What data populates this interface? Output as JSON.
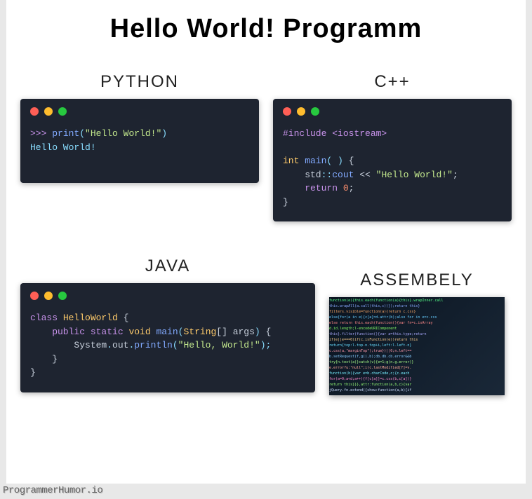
{
  "title": "Hello World!  Programm",
  "watermark": "ProgrammerHumor.io",
  "panels": {
    "python": {
      "label": "PYTHON",
      "code": {
        "prompt": ">>> ",
        "fn": "print",
        "open": "(",
        "str": "\"Hello World!\"",
        "close": ")",
        "output": "Hello World!"
      }
    },
    "cpp": {
      "label": "C++",
      "code": {
        "include": "#include <iostream>",
        "l1_a": "int",
        "l1_b": " main",
        "l1_c": "( )",
        "l1_d": " {",
        "l2_a": "    std",
        "l2_b": "::",
        "l2_c": "cout",
        "l2_d": " << ",
        "l2_e": "\"Hello World!\"",
        "l2_f": ";",
        "l3_a": "    return ",
        "l3_b": "0",
        "l3_c": ";",
        "l4": "}"
      }
    },
    "java": {
      "label": "JAVA",
      "code": {
        "l1_a": "class ",
        "l1_b": "HelloWorld",
        "l1_c": " {",
        "l2_a": "    public static ",
        "l2_b": "void",
        "l2_c": " main",
        "l2_d": "(",
        "l2_e": "String",
        "l2_f": "[] args",
        "l2_g": ")",
        "l2_h": " {",
        "l3_a": "        System",
        "l3_b": ".",
        "l3_c": "out",
        "l3_d": ".",
        "l3_e": "println",
        "l3_f": "(",
        "l3_g": "\"Hello, World!\"",
        "l3_h": ");",
        "l4": "    }",
        "l5": "}"
      }
    },
    "asm": {
      "label": "ASSEMBELY"
    }
  }
}
